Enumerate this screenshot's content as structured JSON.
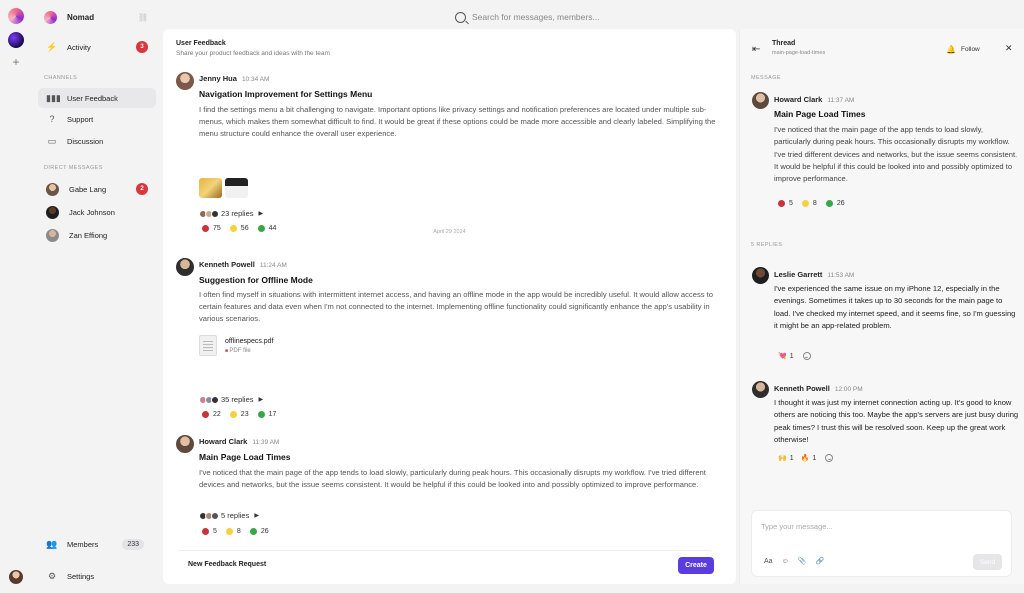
{
  "search": {
    "placeholder": "Search for messages, members..."
  },
  "workspace": {
    "name": "Nomad",
    "add": "+"
  },
  "sidebar": {
    "activity": {
      "label": "Activity",
      "badge": "3"
    },
    "channels_heading": "CHANNELS",
    "channels": [
      {
        "label": "User Feedback",
        "active": true
      },
      {
        "label": "Support"
      },
      {
        "label": "Discussion"
      }
    ],
    "dm_heading": "DIRECT MESSAGES",
    "dms": [
      {
        "label": "Gabe Lang",
        "badge": "2"
      },
      {
        "label": "Jack Johnson"
      },
      {
        "label": "Zan Effiong"
      }
    ],
    "members": {
      "label": "Members",
      "count": "233"
    },
    "settings": {
      "label": "Settings"
    }
  },
  "channel": {
    "title": "User Feedback",
    "subtitle": "Share your product feedback and ideas with the team",
    "date_separator": "April 29 2024",
    "messages": [
      {
        "author": "Jenny Hua",
        "time": "10:34 AM",
        "subject": "Navigation Improvement for Settings Menu",
        "body": "I find the settings menu a bit challenging to navigate. Important options like privacy settings and notification preferences are located under multiple sub-menus, which makes them somewhat difficult to find. It would be great if these options could be made more accessible and clearly labeled. Simplifying the menu structure could enhance the overall user experience.",
        "replies": "23 replies",
        "reactions": [
          "75",
          "56",
          "44"
        ]
      },
      {
        "author": "Kenneth Powell",
        "time": "11:24 AM",
        "subject": "Suggestion for Offline Mode",
        "body": "I often find myself in situations with intermittent internet access, and having an offline mode in the app would be incredibly useful. It would allow access to certain features and data even when I'm not connected to the internet. Implementing offline functionality could significantly enhance the app's usability in various scenarios.",
        "file": {
          "name": "offlinespecs.pdf",
          "type": "PDF file"
        },
        "replies": "35 replies",
        "reactions": [
          "22",
          "23",
          "17"
        ]
      },
      {
        "author": "Howard Clark",
        "time": "11:39 AM",
        "subject": "Main Page Load Times",
        "body": "I've noticed that the main page of the app tends to load slowly, particularly during peak hours. This occasionally disrupts my workflow. I've tried different devices and networks, but the issue seems consistent. It would be helpful if this could be looked into and possibly optimized to improve performance.",
        "replies": "5 replies",
        "reactions": [
          "5",
          "8",
          "26"
        ]
      }
    ],
    "composer": {
      "title": "New Feedback Request",
      "button": "Create"
    }
  },
  "thread": {
    "title": "Thread",
    "subtitle": "main-page-load-times",
    "follow": "Follow",
    "message_label": "MESSAGE",
    "root": {
      "author": "Howard Clark",
      "time": "11:37 AM",
      "subject": "Main Page Load Times",
      "body": "I've noticed that the main page of the app tends to load slowly, particularly during peak hours. This occasionally disrupts my workflow. I've tried different devices and networks, but the issue seems consistent. It would be helpful if this could be looked into and possibly optimized to improve performance.",
      "reactions": [
        "5",
        "8",
        "26"
      ]
    },
    "replies_label": "5 REPLIES",
    "replies": [
      {
        "author": "Leslie Garrett",
        "time": "11:53 AM",
        "body": "I've experienced the same issue on my iPhone 12, especially in the evenings. Sometimes it takes up to 30 seconds for the main page to load. I've checked my internet speed, and it seems fine, so I'm guessing it might be an app-related problem.",
        "reactions": [
          "1"
        ]
      },
      {
        "author": "Kenneth Powell",
        "time": "12:00 PM",
        "body": "I thought it was just my internet connection acting up. It's good to know others are noticing this too. Maybe the app's servers are just busy during peak times? I trust this will be resolved soon. Keep up the great work otherwise!",
        "reactions": [
          "1",
          "1"
        ]
      }
    ],
    "composer": {
      "placeholder": "Type your message...",
      "format": "Aa",
      "send": "Send"
    }
  },
  "colors": {
    "accent": "#5a3de0",
    "badge": "#d9363e"
  }
}
